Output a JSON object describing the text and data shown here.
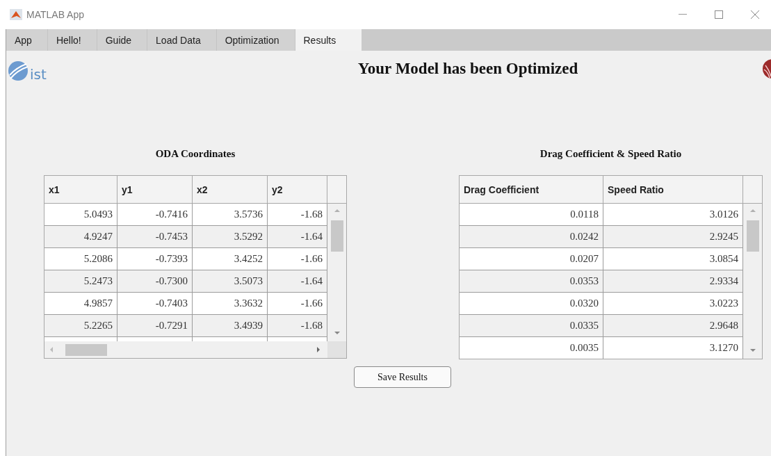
{
  "window": {
    "title": "MATLAB App"
  },
  "tabs": [
    {
      "label": "App",
      "selected": false
    },
    {
      "label": "Hello!",
      "selected": false
    },
    {
      "label": "Guide",
      "selected": false
    },
    {
      "label": "Load Data",
      "selected": false
    },
    {
      "label": "Optimization",
      "selected": false
    },
    {
      "label": "Results",
      "selected": true
    }
  ],
  "logo": {
    "text": "ist"
  },
  "heading": "Your Model has been Optimized",
  "coordinates_table": {
    "title": "ODA Coordinates",
    "columns": [
      "x1",
      "y1",
      "x2",
      "y2"
    ],
    "rows": [
      [
        "5.0493",
        "-0.7416",
        "3.5736",
        "-1.68"
      ],
      [
        "4.9247",
        "-0.7453",
        "3.5292",
        "-1.64"
      ],
      [
        "5.2086",
        "-0.7393",
        "3.4252",
        "-1.66"
      ],
      [
        "5.2473",
        "-0.7300",
        "3.5073",
        "-1.64"
      ],
      [
        "4.9857",
        "-0.7403",
        "3.3632",
        "-1.66"
      ],
      [
        "5.2265",
        "-0.7291",
        "3.4939",
        "-1.68"
      ]
    ]
  },
  "results_table": {
    "title": "Drag Coefficient & Speed Ratio",
    "columns": [
      "Drag Coefficient",
      "Speed Ratio"
    ],
    "rows": [
      [
        "0.0118",
        "3.0126"
      ],
      [
        "0.0242",
        "2.9245"
      ],
      [
        "0.0207",
        "3.0854"
      ],
      [
        "0.0353",
        "2.9334"
      ],
      [
        "0.0320",
        "3.0223"
      ],
      [
        "0.0335",
        "2.9648"
      ],
      [
        "0.0035",
        "3.1270"
      ]
    ]
  },
  "save_button": {
    "label": "Save Results"
  }
}
